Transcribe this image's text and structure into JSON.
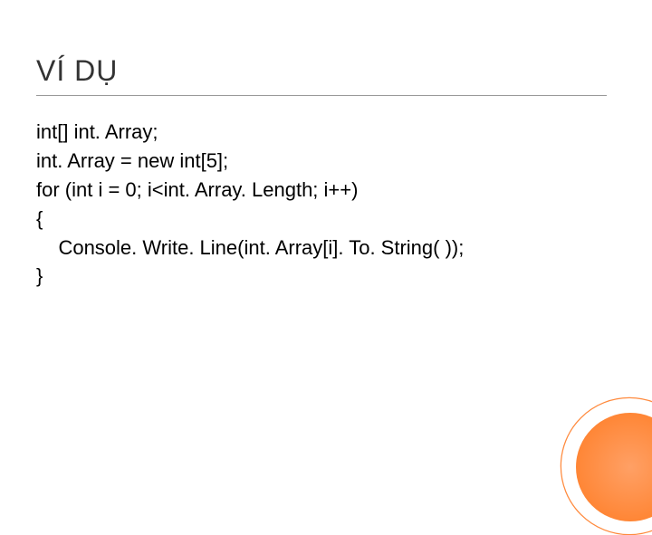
{
  "slide": {
    "title": "VÍ DỤ",
    "code_lines": [
      "int[] int. Array;",
      "int. Array = new int[5];",
      "for (int i = 0; i<int. Array. Length; i++)",
      "{",
      "    Console. Write. Line(int. Array[i]. To. String( ));",
      "}"
    ]
  }
}
